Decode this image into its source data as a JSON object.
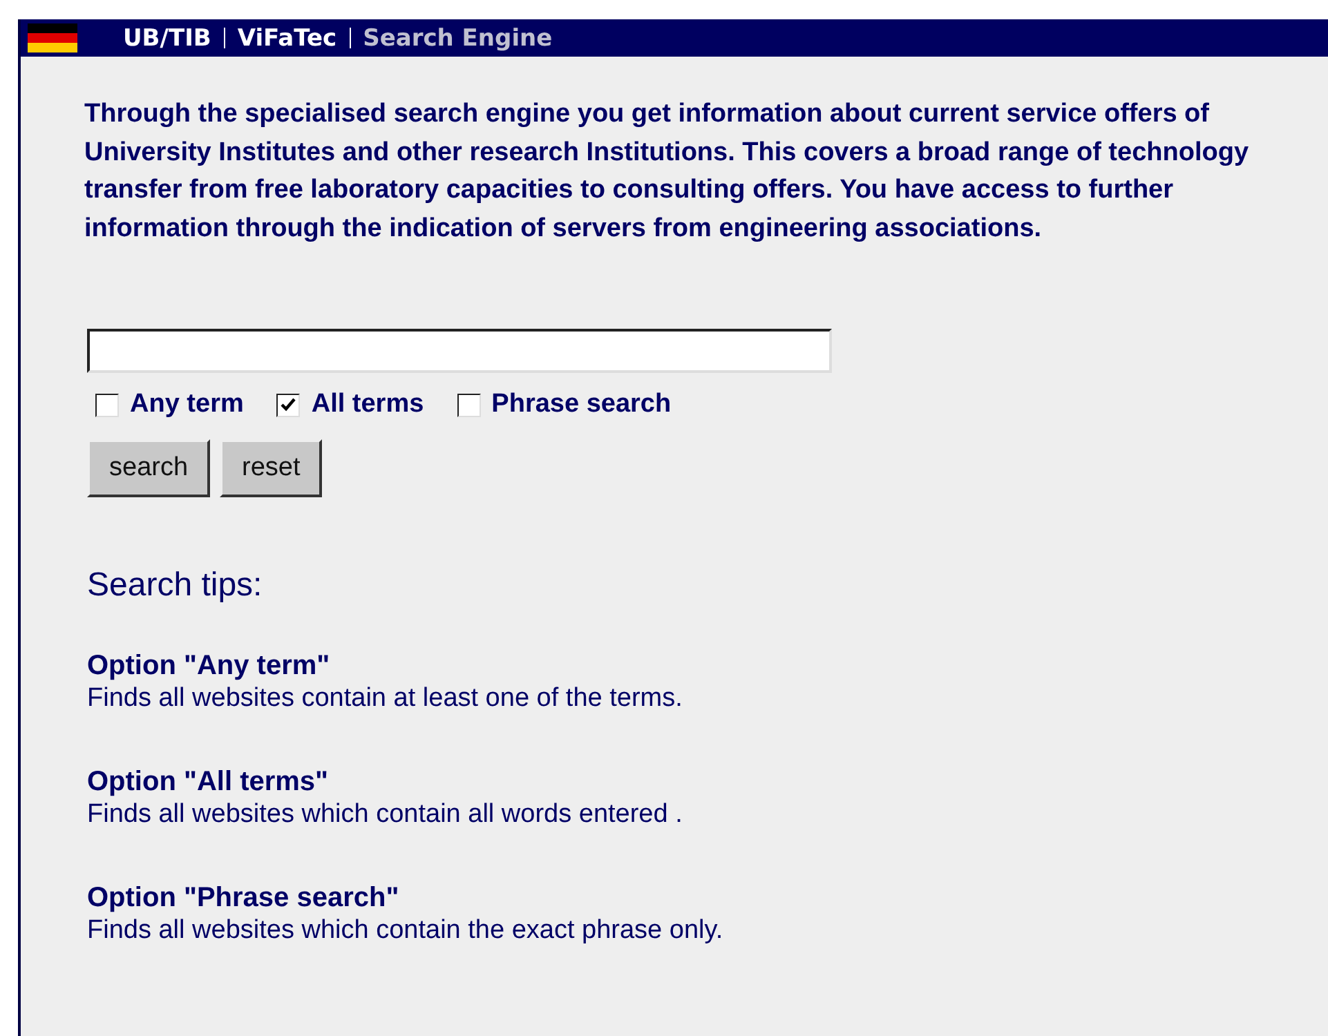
{
  "header": {
    "links": [
      {
        "label": "UB/TIB",
        "selected": false
      },
      {
        "label": "ViFaTec",
        "selected": false
      },
      {
        "label": "Search Engine",
        "selected": true
      }
    ]
  },
  "intro": "Through the specialised search engine you get information about current service offers of University Institutes and other research Institutions. This covers a broad range of technology transfer from free laboratory capacities to consulting offers. You have access to further information through the indication of servers from engineering associations.",
  "search": {
    "options": [
      {
        "label": "Any term",
        "checked": false
      },
      {
        "label": "All terms",
        "checked": true
      },
      {
        "label": "Phrase search",
        "checked": false
      }
    ],
    "buttons": [
      "search",
      "reset"
    ]
  },
  "tips": {
    "title": "Search tips:",
    "items": [
      {
        "heading": "Option \"Any term\"",
        "text": "Finds all websites contain at least one of the terms."
      },
      {
        "heading": "Option \"All terms\"",
        "text": "Finds all websites which contain all words entered ."
      },
      {
        "heading": "Option \"Phrase search\"",
        "text": "Finds all websites which contain the exact phrase only."
      }
    ]
  }
}
